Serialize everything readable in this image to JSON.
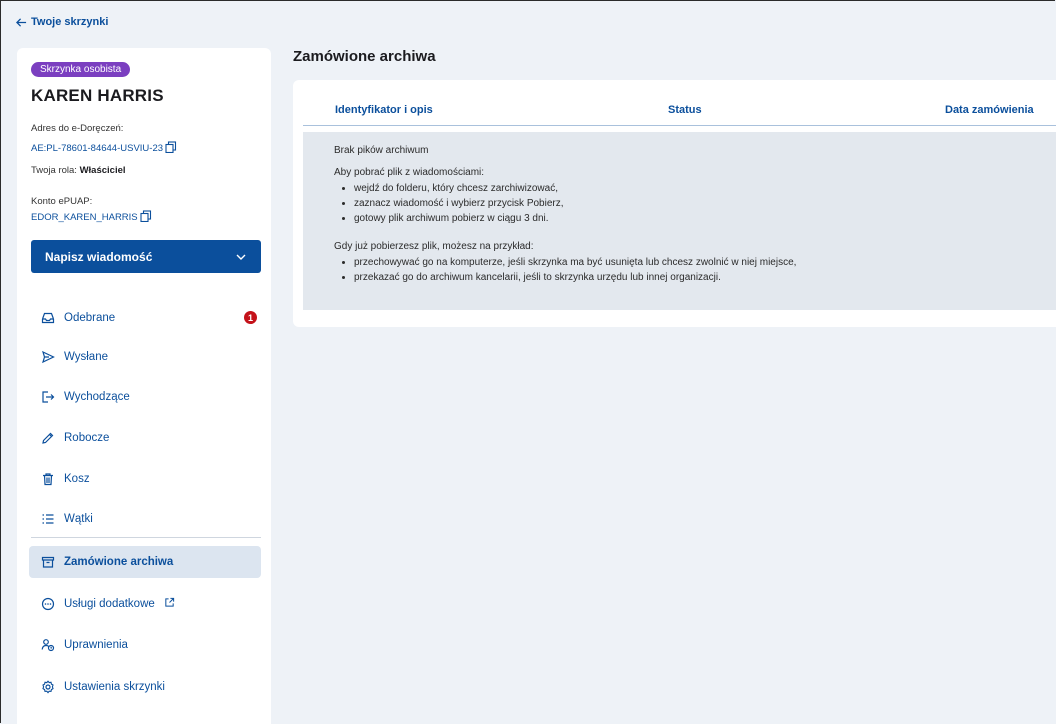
{
  "back_link": {
    "label": "Twoje skrzynki"
  },
  "sidebar": {
    "badge": "Skrzynka osobista",
    "owner_name": "KAREN HARRIS",
    "address_label": "Adres do e-Doręczeń:",
    "address_value": "AE:PL-78601-84644-USVIU-23",
    "role_label": "Twoja rola:",
    "role_value": "Właściciel",
    "epuap_label": "Konto ePUAP:",
    "epuap_value": "EDOR_KAREN_HARRIS",
    "compose_label": "Napisz wiadomość",
    "items": [
      {
        "label": "Odebrane",
        "icon": "inbox-icon",
        "count": "1"
      },
      {
        "label": "Wysłane",
        "icon": "send-icon"
      },
      {
        "label": "Wychodzące",
        "icon": "outgoing-icon"
      },
      {
        "label": "Robocze",
        "icon": "pencil-icon"
      },
      {
        "label": "Kosz",
        "icon": "trash-icon"
      },
      {
        "label": "Wątki",
        "icon": "list-icon"
      },
      {
        "label": "Zamówione archiwa",
        "icon": "archive-icon",
        "active": true
      },
      {
        "label": "Usługi dodatkowe",
        "icon": "more-icon",
        "external": true
      },
      {
        "label": "Uprawnienia",
        "icon": "users-icon"
      },
      {
        "label": "Ustawienia skrzynki",
        "icon": "gear-icon"
      }
    ]
  },
  "main": {
    "title": "Zamówione archiwa",
    "columns": [
      "Identyfikator i opis",
      "Status",
      "Data zamówienia"
    ],
    "empty": {
      "heading": "Brak pików archiwum",
      "intro": "Aby pobrać plik z wiadomościami:",
      "steps": [
        "wejdź do folderu, który chcesz zarchiwizować,",
        "zaznacz wiadomość i wybierz przycisk Pobierz,",
        "gotowy plik archiwum pobierz w ciągu 3 dni."
      ],
      "after": "Gdy już pobierzesz plik, możesz na przykład:",
      "tips": [
        "przechowywać go na komputerze, jeśli skrzynka ma być usunięta lub chcesz zwolnić w niej miejsce,",
        "przekazać go do archiwum kancelarii, jeśli to skrzynka urzędu lub innej organizacji."
      ]
    }
  },
  "colors": {
    "accent": "#0b4f9c",
    "badge": "#7b3fc0",
    "alert": "#c4121a",
    "active_bg": "#dce5f0"
  }
}
